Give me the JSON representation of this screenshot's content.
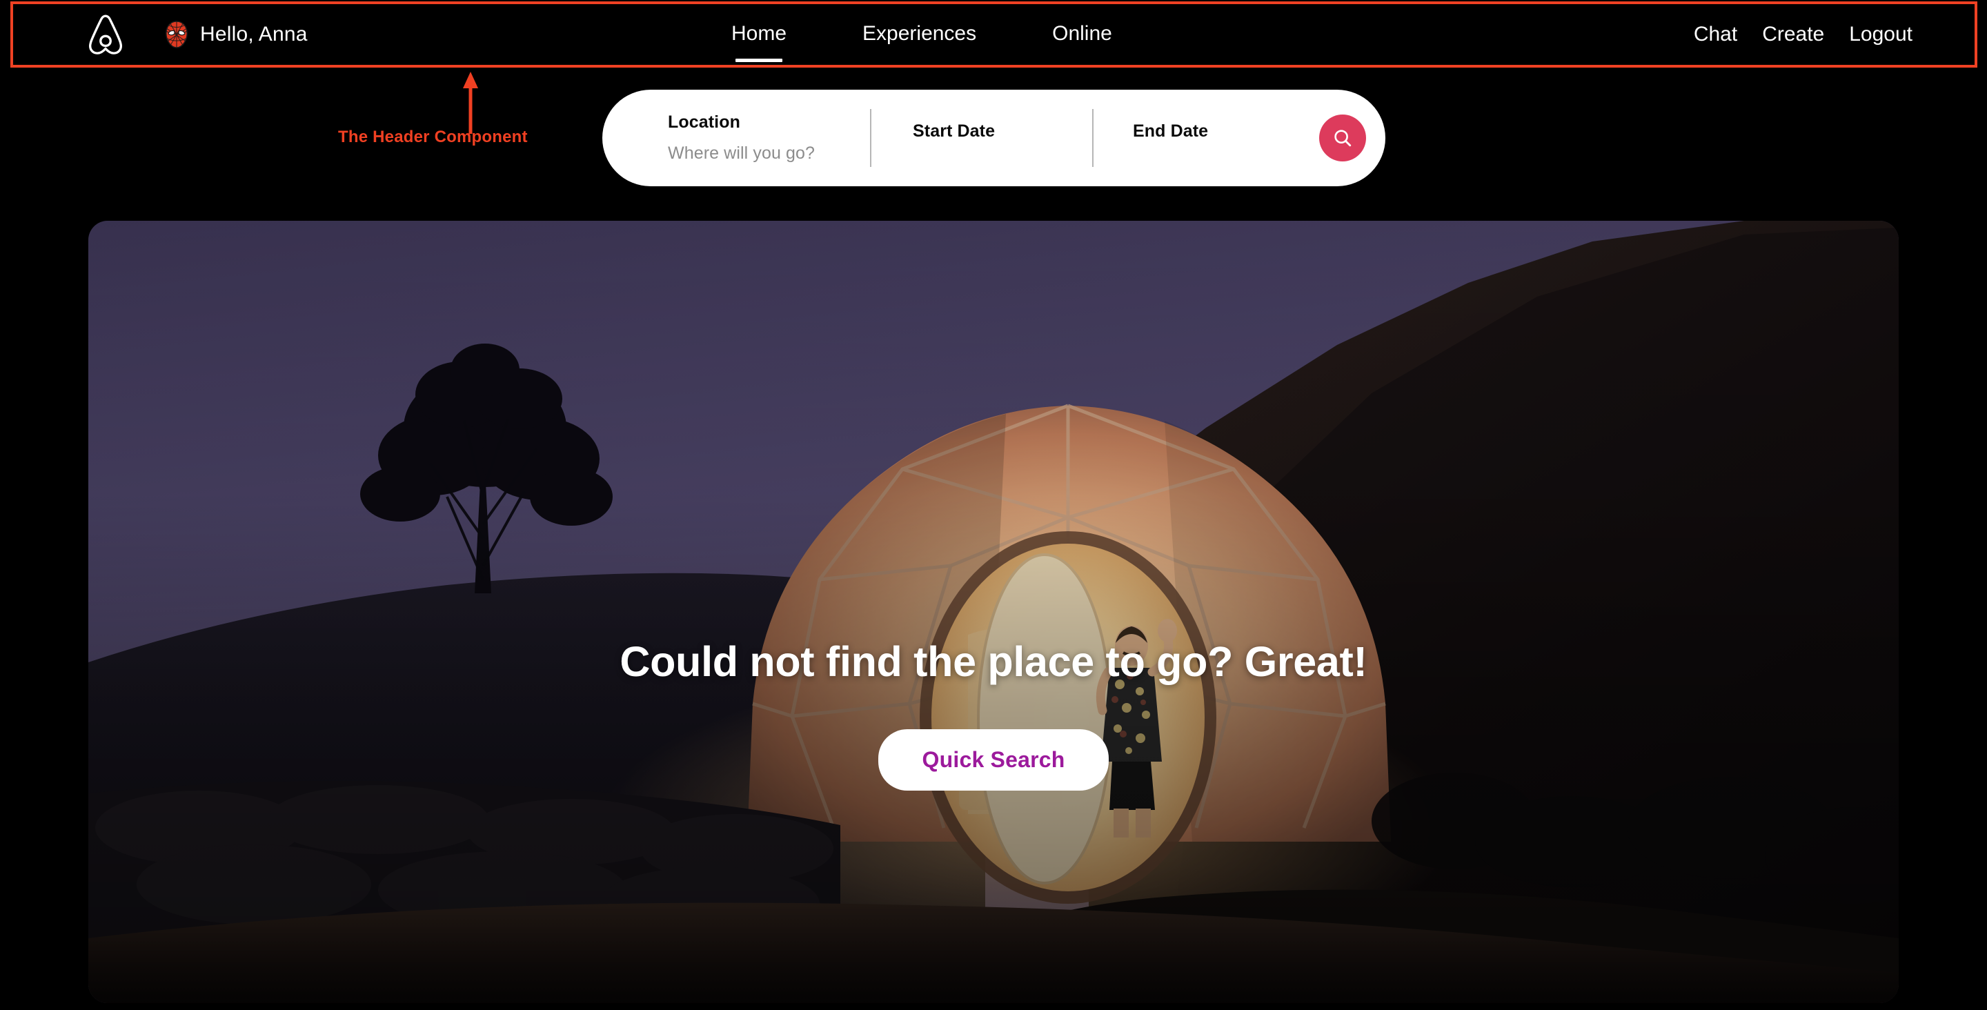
{
  "header": {
    "logo_icon": "airbnb-belo-logo",
    "avatar_icon": "spiderman-mask-avatar",
    "greeting": "Hello, Anna",
    "nav": [
      {
        "label": "Home",
        "active": true
      },
      {
        "label": "Experiences",
        "active": false
      },
      {
        "label": "Online",
        "active": false
      }
    ],
    "right_nav": [
      {
        "label": "Chat"
      },
      {
        "label": "Create"
      },
      {
        "label": "Logout"
      }
    ]
  },
  "annotation": {
    "label": "The Header Component",
    "color": "#F04022",
    "arrow_icon": "up-arrow-icon"
  },
  "search": {
    "location": {
      "label": "Location",
      "placeholder": "Where will you go?",
      "value": ""
    },
    "start_date": {
      "label": "Start Date",
      "placeholder": "",
      "value": ""
    },
    "end_date": {
      "label": "End Date",
      "placeholder": "",
      "value": ""
    },
    "submit_icon": "search-icon",
    "submit_color": "#DD3B5C"
  },
  "hero": {
    "image_alt": "geodesic-glamping-dome-at-dusk",
    "title": "Could not find the place to go? Great!",
    "cta_label": "Quick Search",
    "cta_text_color": "#9C1A9C"
  },
  "colors": {
    "background": "#000000",
    "accent_red": "#EF4123",
    "brand_rose": "#DD3B5C",
    "cta_purple": "#9C1A9C",
    "text_light": "#FFFFFF"
  }
}
